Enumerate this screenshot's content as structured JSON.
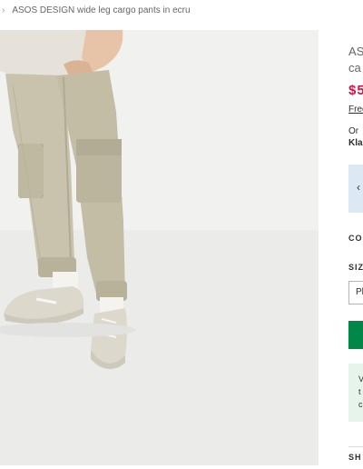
{
  "breadcrumb": {
    "separator": "›",
    "current": "ASOS DESIGN wide leg cargo pants in ecru"
  },
  "product": {
    "title_line1": "AS",
    "title_line2": "ca",
    "price": "$5",
    "free_shipping": "Free",
    "pay_later_prefix": "Or",
    "klarna": "Klar",
    "promo_chevron": "‹",
    "colour_label": "CO",
    "size_label": "SIZ",
    "size_placeholder": "Pl",
    "info_line1": "V",
    "info_line2": "t",
    "info_line3": "c",
    "next_section": "SH"
  },
  "colors": {
    "price": "#d01345",
    "add_to_bag": "#018849",
    "promo_bg": "#dce8f4",
    "info_bg": "#e6f4ec",
    "hero_bg": "#efefef"
  }
}
